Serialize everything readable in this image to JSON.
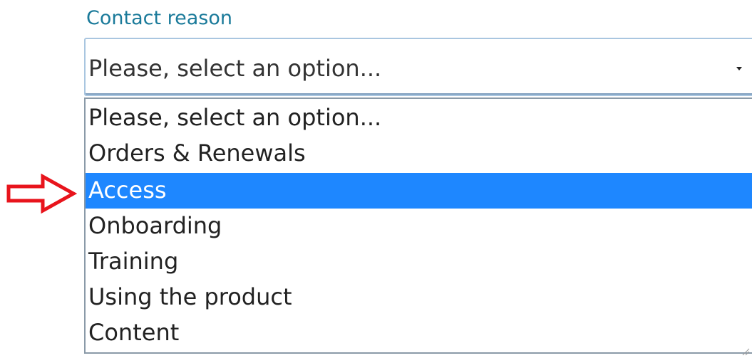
{
  "form": {
    "label": "Contact reason",
    "select": {
      "current_value": "Please, select an option...",
      "caret_icon": "caret-down-icon"
    },
    "options": [
      {
        "label": "Please, select an option...",
        "selected": false
      },
      {
        "label": "Orders & Renewals",
        "selected": false
      },
      {
        "label": "Access",
        "selected": true
      },
      {
        "label": "Onboarding",
        "selected": false
      },
      {
        "label": "Training",
        "selected": false
      },
      {
        "label": "Using the product",
        "selected": false
      },
      {
        "label": "Content",
        "selected": false
      }
    ]
  },
  "annotation": {
    "icon": "red-arrow-right-icon",
    "color": "#e8141c"
  },
  "colors": {
    "label_color": "#1a7a9a",
    "highlight": "#1e87ff",
    "border": "#a9c6e0"
  }
}
